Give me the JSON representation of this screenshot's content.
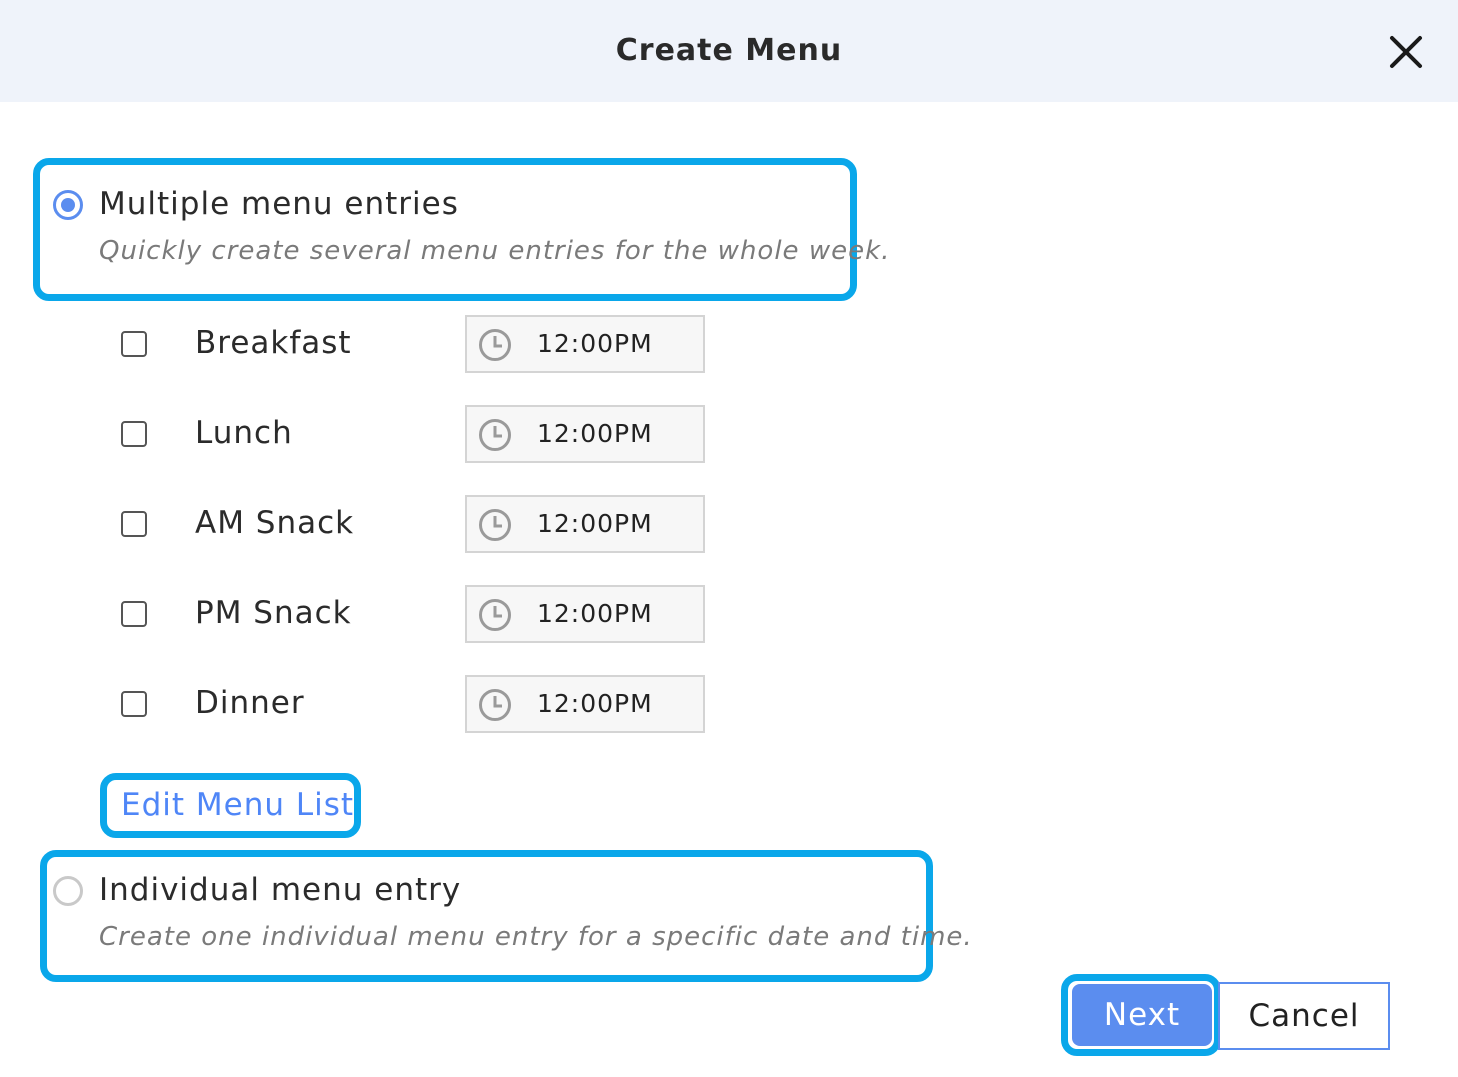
{
  "dialog": {
    "title": "Create Menu",
    "close_icon": "close-icon"
  },
  "options": {
    "multiple": {
      "label": "Multiple menu entries",
      "description": "Quickly create several menu entries for the whole week.",
      "selected": true
    },
    "individual": {
      "label": "Individual menu entry",
      "description": "Create one individual menu entry for a specific date and time.",
      "selected": false
    }
  },
  "meals": [
    {
      "label": "Breakfast",
      "time": "12:00PM",
      "checked": false
    },
    {
      "label": "Lunch",
      "time": "12:00PM",
      "checked": false
    },
    {
      "label": "AM Snack",
      "time": "12:00PM",
      "checked": false
    },
    {
      "label": "PM Snack",
      "time": "12:00PM",
      "checked": false
    },
    {
      "label": "Dinner",
      "time": "12:00PM",
      "checked": false
    }
  ],
  "edit_link": "Edit Menu List",
  "buttons": {
    "next": "Next",
    "cancel": "Cancel"
  },
  "colors": {
    "accent": "#5b8def",
    "highlight": "#0aa7ea",
    "header_bg": "#eff3fa"
  }
}
